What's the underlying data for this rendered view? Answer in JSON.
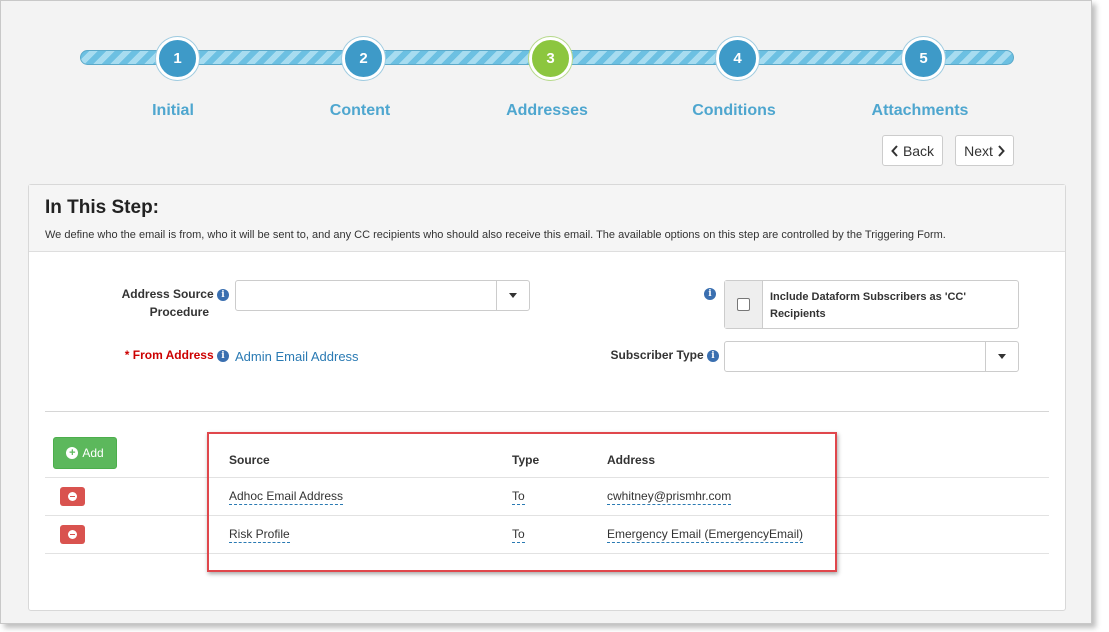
{
  "wizard": {
    "steps": [
      {
        "number": "1",
        "label": "Initial"
      },
      {
        "number": "2",
        "label": "Content"
      },
      {
        "number": "3",
        "label": "Addresses"
      },
      {
        "number": "4",
        "label": "Conditions"
      },
      {
        "number": "5",
        "label": "Attachments"
      }
    ],
    "active_step": 3,
    "back_label": "Back",
    "next_label": "Next",
    "back_icon": "chevron-left-icon",
    "next_icon": "chevron-right-icon"
  },
  "panel": {
    "title": "In This Step:",
    "description": "We define who the email is from, who it will be sent to, and any CC recipients who should also receive this email. The available options on this step are controlled by the Triggering Form."
  },
  "form": {
    "address_source_label_1": "Address Source",
    "address_source_label_2": "Procedure",
    "address_source_value": "",
    "from_address_required": "*",
    "from_address_label": "From Address",
    "from_address_value": "Admin Email Address",
    "cc_label": "Include Dataform Subscribers as 'CC' Recipients",
    "cc_checked": false,
    "subscriber_type_label": "Subscriber Type",
    "subscriber_type_value": "",
    "info_glyph": "i"
  },
  "recipients": {
    "add_label": "Add",
    "columns": {
      "source": "Source",
      "type": "Type",
      "address": "Address"
    },
    "rows": [
      {
        "source": "Adhoc Email Address",
        "type": "To",
        "address": "cwhitney@prismhr.com"
      },
      {
        "source": "Risk Profile",
        "type": "To",
        "address": "Emergency Email (EmergencyEmail)"
      }
    ]
  },
  "colors": {
    "step_blue": "#3e9ac8",
    "step_active_green": "#8cc63f",
    "add_green": "#5cb85c",
    "delete_red": "#d9534f",
    "highlight_red": "#e0474c",
    "link_blue": "#2a7ab3"
  }
}
